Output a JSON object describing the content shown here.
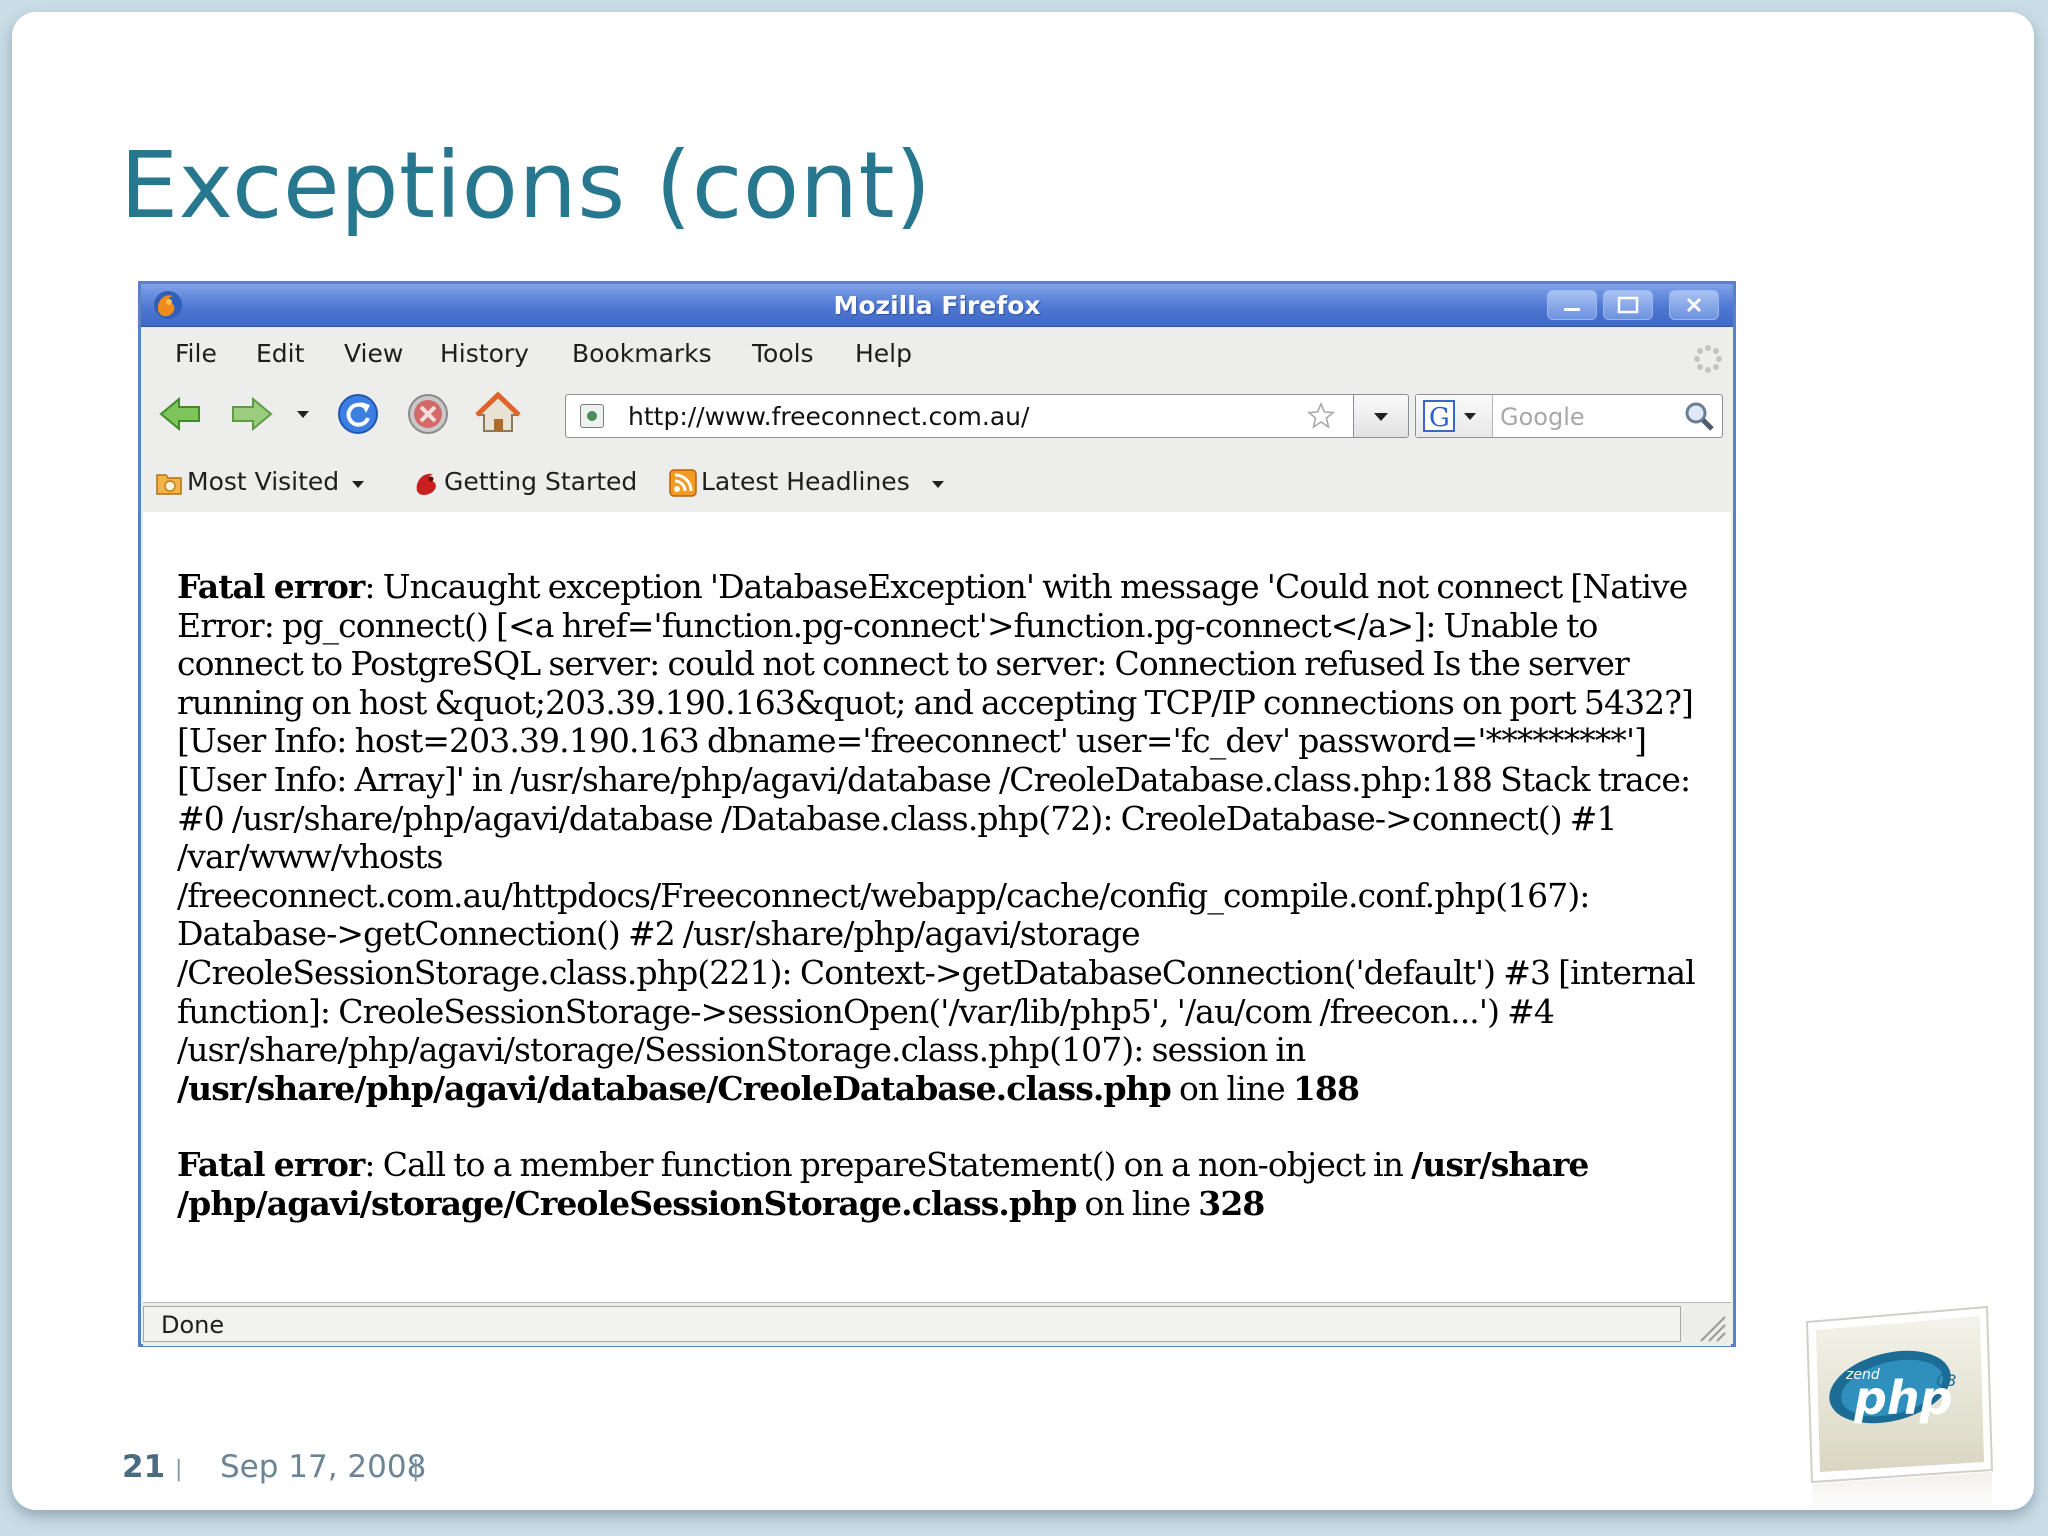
{
  "slide": {
    "title": "Exceptions (cont)",
    "page_number": "21",
    "separator": "|",
    "date": "Sep 17, 2008"
  },
  "window": {
    "title": "Mozilla Firefox",
    "app_icon": "firefox-icon",
    "controls": [
      "minimize-icon",
      "maximize-icon",
      "close-icon"
    ]
  },
  "menubar": {
    "items": [
      {
        "label": "File"
      },
      {
        "label": "Edit"
      },
      {
        "label": "View"
      },
      {
        "label": "History"
      },
      {
        "label": "Bookmarks"
      },
      {
        "label": "Tools"
      },
      {
        "label": "Help"
      }
    ]
  },
  "navbar": {
    "url": "http://www.freeconnect.com.au/",
    "search_placeholder": "Google",
    "icons": [
      "back-arrow-icon",
      "forward-arrow-icon",
      "history-dropdown-icon",
      "reload-icon",
      "stop-icon",
      "home-icon",
      "star-icon",
      "search-icon"
    ]
  },
  "bookmarks": {
    "items": [
      {
        "label": "Most Visited",
        "icon": "folder-icon"
      },
      {
        "label": "Getting Started",
        "icon": "firefox-bookmark-icon"
      },
      {
        "label": "Latest Headlines",
        "icon": "rss-feed-icon"
      }
    ]
  },
  "content": {
    "error1": {
      "label": "Fatal error",
      "message": ": Uncaught exception 'DatabaseException' with message 'Could not connect [Native Error: pg_connect() [<a href='function.pg-connect'>function.pg-connect</a>]: Unable to connect to PostgreSQL server: could not connect to server: Connection refused Is the server running on host &quot;203.39.190.163&quot; and accepting TCP/IP connections on port 5432?] [User Info: host=203.39.190.163 dbname='freeconnect' user='fc_dev' password='*********'] [User Info: Array]' in /usr/share/php/agavi/database /CreoleDatabase.class.php:188 Stack trace: #0 /usr/share/php/agavi/database /Database.class.php(72): CreoleDatabase->connect() #1 /var/www/vhosts /freeconnect.com.au/httpdocs/Freeconnect/webapp/cache/config_compile.conf.php(167): Database->getConnection() #2 /usr/share/php/agavi/storage /CreoleSessionStorage.class.php(221): Context->getDatabaseConnection('default') #3 [internal function]: CreoleSessionStorage->sessionOpen('/var/lib/php5', '/au/com /freecon...') #4 /usr/share/php/agavi/storage/SessionStorage.class.php(107): session in ",
      "file": "/usr/share/php/agavi/database/CreoleDatabase.class.php",
      "on_line": " on line ",
      "line": "188"
    },
    "error2": {
      "label": "Fatal error",
      "message": ": Call to a member function prepareStatement() on a non-object in ",
      "file": "/usr/share /php/agavi/storage/CreoleSessionStorage.class.php",
      "on_line": " on line ",
      "line": "328"
    }
  },
  "statusbar": {
    "text": "Done"
  },
  "logo": {
    "text_small": "zend",
    "text_main": "php",
    "text_year": "08"
  }
}
